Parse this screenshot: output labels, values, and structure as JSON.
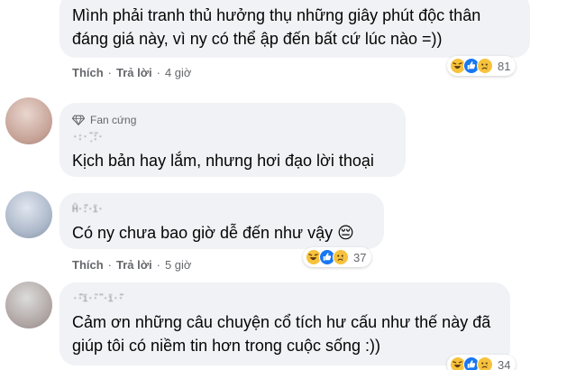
{
  "comments": [
    {
      "text": "Mình phải tranh thủ hưởng thụ những giây phút độc thân đáng giá này, vì ny có thể ập đến bất cứ lúc nào =))",
      "actions": {
        "like": "Thích",
        "reply": "Trả lời",
        "time": "4 giờ"
      },
      "reactions": {
        "icons": [
          "haha-icon",
          "like-icon",
          "sad-icon"
        ],
        "count": "81"
      }
    },
    {
      "badge": "Fan cứng",
      "author_blurred": "·:·̣̣̣̣̃ ̃:·",
      "text": "Kịch bản hay lắm, nhưng hơi đạo lời thoại"
    },
    {
      "author_blurred": "Ĥ·̃̃:·ĩ·",
      "text": "Có ny chưa bao giờ dễ đến như vậy 😔",
      "actions": {
        "like": "Thích",
        "reply": "Trả lời",
        "time": "5 giờ"
      },
      "reactions": {
        "icons": [
          "haha-icon",
          "like-icon",
          "sad-icon"
        ],
        "count": "37"
      }
    },
    {
      "author_blurred": "·̃̃̃·ĩ·̃·̃̃ ·ĩ·̃̃·",
      "text": "Cảm ơn những câu chuyện cổ tích hư cấu như thế này đã giúp tôi có niềm tin hơn trong cuộc sống :))",
      "reactions": {
        "icons": [
          "haha-icon",
          "like-icon",
          "sad-icon"
        ],
        "count": "34"
      }
    }
  ],
  "colors": {
    "bubble": "#f0f2f5",
    "text": "#050505",
    "meta": "#65676b",
    "like_blue": "#1877f2",
    "haha_yellow": "#f7c23c"
  }
}
